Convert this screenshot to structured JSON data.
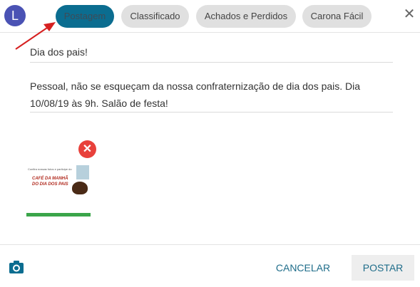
{
  "avatar": {
    "initial": "L"
  },
  "tabs": [
    {
      "label": "Postagem",
      "active": true
    },
    {
      "label": "Classificado",
      "active": false
    },
    {
      "label": "Achados e Perdidos",
      "active": false
    },
    {
      "label": "Carona Fácil",
      "active": false
    }
  ],
  "close_icon": "close-icon",
  "post": {
    "title": "Dia dos pais!",
    "body": "Pessoal, não se esqueçam da nossa confraternização de dia dos pais. Dia 10/08/19 às 9h. Salão de festa!"
  },
  "attachment": {
    "tag": "Confira nossas fotos e participe do",
    "line1": "CAFÉ DA MANHÃ",
    "line2": "DO DIA DOS PAIS"
  },
  "footer": {
    "cancel_label": "CANCELAR",
    "post_label": "POSTAR"
  },
  "colors": {
    "active_tab": "#0b6d90",
    "avatar": "#4a52b4",
    "remove": "#e8413b",
    "annotation_arrow": "#d62020"
  }
}
